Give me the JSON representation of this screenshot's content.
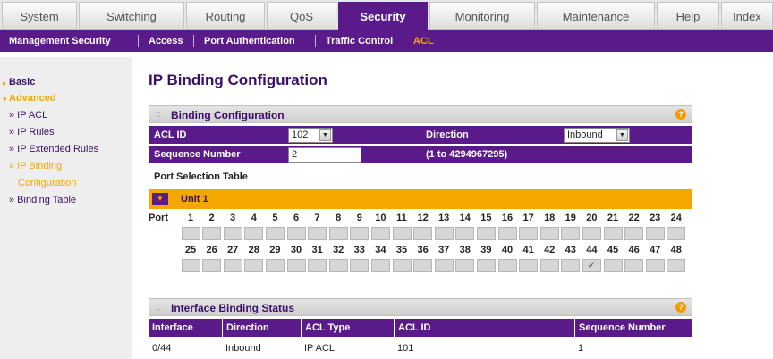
{
  "tabs": [
    "System",
    "Switching",
    "Routing",
    "QoS",
    "Security",
    "Monitoring",
    "Maintenance",
    "Help",
    "Index"
  ],
  "active_tab": "Security",
  "subnav": [
    "Management Security",
    "Access",
    "Port Authentication",
    "Traffic Control",
    "ACL"
  ],
  "active_subnav": "ACL",
  "leftnav": {
    "basic": "Basic",
    "advanced": "Advanced",
    "items": [
      "» IP ACL",
      "» IP Rules",
      "» IP Extended Rules",
      "» IP Binding",
      "Configuration",
      "» Binding Table"
    ]
  },
  "page_title": "IP Binding Configuration",
  "binding_config": {
    "title": "Binding Configuration",
    "acl_id_label": "ACL ID",
    "acl_id_value": "102",
    "direction_label": "Direction",
    "direction_value": "Inbound",
    "seq_label": "Sequence Number",
    "seq_value": "2",
    "seq_range": "(1 to 4294967295)",
    "pst_label": "Port Selection Table",
    "unit_label": "Unit 1",
    "port_label": "Port",
    "ports_row1": [
      "1",
      "2",
      "3",
      "4",
      "5",
      "6",
      "7",
      "8",
      "9",
      "10",
      "11",
      "12",
      "13",
      "14",
      "15",
      "16",
      "17",
      "18",
      "19",
      "20",
      "21",
      "22",
      "23",
      "24"
    ],
    "ports_row2": [
      "25",
      "26",
      "27",
      "28",
      "29",
      "30",
      "31",
      "32",
      "33",
      "34",
      "35",
      "36",
      "37",
      "38",
      "39",
      "40",
      "41",
      "42",
      "43",
      "44",
      "45",
      "46",
      "47",
      "48"
    ],
    "checked_port": "44",
    "check_glyph": "✓"
  },
  "status": {
    "title": "Interface Binding Status",
    "headers": [
      "Interface",
      "Direction",
      "ACL Type",
      "ACL ID",
      "Sequence Number"
    ],
    "rows": [
      [
        "0/44",
        "Inbound",
        "IP ACL",
        "101",
        "1"
      ]
    ]
  },
  "colors": {
    "purple": "#5a1a8a",
    "orange": "#f5a700"
  }
}
